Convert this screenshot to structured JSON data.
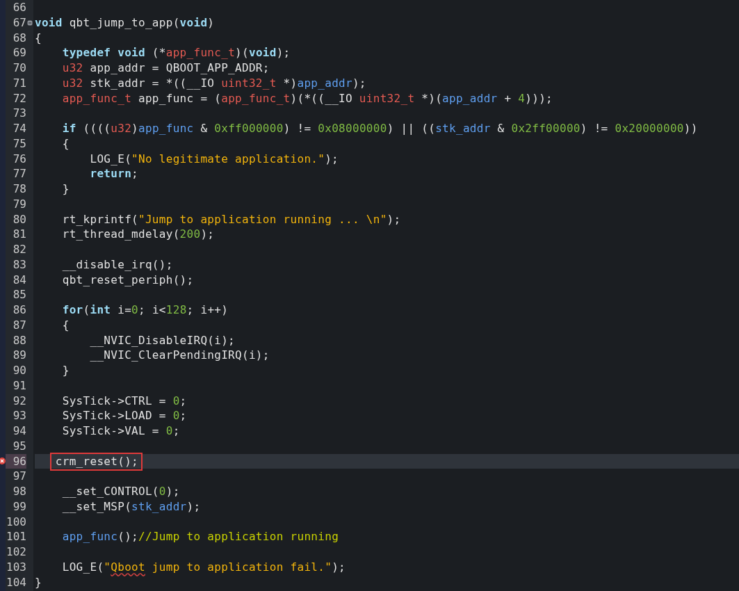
{
  "editor": {
    "lines": [
      {
        "number": "66",
        "current": false,
        "error": false
      },
      {
        "number": "67",
        "current": false,
        "error": false,
        "expanded": true,
        "tokens": [
          {
            "kind": "keyword",
            "text": "void"
          },
          {
            "kind": "plain",
            "text": " qbt_jump_to_app("
          },
          {
            "kind": "keyword",
            "text": "void"
          },
          {
            "kind": "plain",
            "text": ")"
          }
        ]
      },
      {
        "number": "68",
        "current": false,
        "error": false,
        "tokens": [
          {
            "kind": "plain",
            "text": "{"
          }
        ]
      },
      {
        "number": "69",
        "current": false,
        "error": false,
        "tokens": [
          {
            "kind": "keyword",
            "text": "    typedef void"
          },
          {
            "kind": "plain",
            "text": " (*"
          },
          {
            "kind": "type",
            "text": "app_func_t"
          },
          {
            "kind": "plain",
            "text": ")("
          },
          {
            "kind": "keyword",
            "text": "void"
          },
          {
            "kind": "plain",
            "text": ");"
          }
        ]
      },
      {
        "number": "70",
        "current": false,
        "error": false,
        "tokens": [
          {
            "kind": "type",
            "text": "    u32"
          },
          {
            "kind": "plain",
            "text": " app_addr = QBOOT_APP_ADDR;"
          }
        ]
      },
      {
        "number": "71",
        "current": false,
        "error": false,
        "tokens": [
          {
            "kind": "type",
            "text": "    u32"
          },
          {
            "kind": "plain",
            "text": " stk_addr = *((__IO "
          },
          {
            "kind": "type",
            "text": "uint32_t"
          },
          {
            "kind": "plain",
            "text": " *)"
          },
          {
            "kind": "var",
            "text": "app_addr"
          },
          {
            "kind": "plain",
            "text": ");"
          }
        ]
      },
      {
        "number": "72",
        "current": false,
        "error": false,
        "tokens": [
          {
            "kind": "type",
            "text": "    app_func_t"
          },
          {
            "kind": "plain",
            "text": " app_func = ("
          },
          {
            "kind": "type",
            "text": "app_func_t"
          },
          {
            "kind": "plain",
            "text": ")(*((__IO "
          },
          {
            "kind": "type",
            "text": "uint32_t"
          },
          {
            "kind": "plain",
            "text": " *)("
          },
          {
            "kind": "var",
            "text": "app_addr"
          },
          {
            "kind": "plain",
            "text": " + "
          },
          {
            "kind": "number",
            "text": "4"
          },
          {
            "kind": "plain",
            "text": ")));"
          }
        ]
      },
      {
        "number": "73",
        "current": false,
        "error": false
      },
      {
        "number": "74",
        "current": false,
        "error": false,
        "tokens": [
          {
            "kind": "keyword",
            "text": "    if"
          },
          {
            "kind": "plain",
            "text": " (((("
          },
          {
            "kind": "type",
            "text": "u32"
          },
          {
            "kind": "plain",
            "text": ")"
          },
          {
            "kind": "var",
            "text": "app_func"
          },
          {
            "kind": "plain",
            "text": " & "
          },
          {
            "kind": "number",
            "text": "0xff000000"
          },
          {
            "kind": "plain",
            "text": ") != "
          },
          {
            "kind": "number",
            "text": "0x08000000"
          },
          {
            "kind": "plain",
            "text": ") || (("
          },
          {
            "kind": "var",
            "text": "stk_addr"
          },
          {
            "kind": "plain",
            "text": " & "
          },
          {
            "kind": "number",
            "text": "0x2ff00000"
          },
          {
            "kind": "plain",
            "text": ") != "
          },
          {
            "kind": "number",
            "text": "0x20000000"
          },
          {
            "kind": "plain",
            "text": "))"
          }
        ]
      },
      {
        "number": "75",
        "current": false,
        "error": false,
        "tokens": [
          {
            "kind": "plain",
            "text": "    {"
          }
        ]
      },
      {
        "number": "76",
        "current": false,
        "error": false,
        "tokens": [
          {
            "kind": "plain",
            "text": "        LOG_E("
          },
          {
            "kind": "string",
            "text": "\"No legitimate application.\""
          },
          {
            "kind": "plain",
            "text": ");"
          }
        ]
      },
      {
        "number": "77",
        "current": false,
        "error": false,
        "tokens": [
          {
            "kind": "keyword",
            "text": "        return"
          },
          {
            "kind": "plain",
            "text": ";"
          }
        ]
      },
      {
        "number": "78",
        "current": false,
        "error": false,
        "tokens": [
          {
            "kind": "plain",
            "text": "    }"
          }
        ]
      },
      {
        "number": "79",
        "current": false,
        "error": false
      },
      {
        "number": "80",
        "current": false,
        "error": false,
        "tokens": [
          {
            "kind": "plain",
            "text": "    rt_kprintf("
          },
          {
            "kind": "string",
            "text": "\"Jump to application running ... \\n\""
          },
          {
            "kind": "plain",
            "text": ");"
          }
        ]
      },
      {
        "number": "81",
        "current": false,
        "error": false,
        "tokens": [
          {
            "kind": "plain",
            "text": "    rt_thread_mdelay("
          },
          {
            "kind": "number",
            "text": "200"
          },
          {
            "kind": "plain",
            "text": ");"
          }
        ]
      },
      {
        "number": "82",
        "current": false,
        "error": false
      },
      {
        "number": "83",
        "current": false,
        "error": false,
        "tokens": [
          {
            "kind": "plain",
            "text": "    __disable_irq();"
          }
        ]
      },
      {
        "number": "84",
        "current": false,
        "error": false,
        "tokens": [
          {
            "kind": "plain",
            "text": "    qbt_reset_periph();"
          }
        ]
      },
      {
        "number": "85",
        "current": false,
        "error": false
      },
      {
        "number": "86",
        "current": false,
        "error": false,
        "tokens": [
          {
            "kind": "keyword",
            "text": "    for"
          },
          {
            "kind": "plain",
            "text": "("
          },
          {
            "kind": "keyword",
            "text": "int"
          },
          {
            "kind": "plain",
            "text": " i="
          },
          {
            "kind": "number",
            "text": "0"
          },
          {
            "kind": "plain",
            "text": "; i<"
          },
          {
            "kind": "number",
            "text": "128"
          },
          {
            "kind": "plain",
            "text": "; i++)"
          }
        ]
      },
      {
        "number": "87",
        "current": false,
        "error": false,
        "tokens": [
          {
            "kind": "plain",
            "text": "    {"
          }
        ]
      },
      {
        "number": "88",
        "current": false,
        "error": false,
        "tokens": [
          {
            "kind": "plain",
            "text": "        __NVIC_DisableIRQ(i);"
          }
        ]
      },
      {
        "number": "89",
        "current": false,
        "error": false,
        "tokens": [
          {
            "kind": "plain",
            "text": "        __NVIC_ClearPendingIRQ(i);"
          }
        ]
      },
      {
        "number": "90",
        "current": false,
        "error": false,
        "tokens": [
          {
            "kind": "plain",
            "text": "    }"
          }
        ]
      },
      {
        "number": "91",
        "current": false,
        "error": false
      },
      {
        "number": "92",
        "current": false,
        "error": false,
        "tokens": [
          {
            "kind": "plain",
            "text": "    SysTick->CTRL = "
          },
          {
            "kind": "number",
            "text": "0"
          },
          {
            "kind": "plain",
            "text": ";"
          }
        ]
      },
      {
        "number": "93",
        "current": false,
        "error": false,
        "tokens": [
          {
            "kind": "plain",
            "text": "    SysTick->LOAD = "
          },
          {
            "kind": "number",
            "text": "0"
          },
          {
            "kind": "plain",
            "text": ";"
          }
        ]
      },
      {
        "number": "94",
        "current": false,
        "error": false,
        "tokens": [
          {
            "kind": "plain",
            "text": "    SysTick->VAL = "
          },
          {
            "kind": "number",
            "text": "0"
          },
          {
            "kind": "plain",
            "text": ";"
          }
        ]
      },
      {
        "number": "95",
        "current": false,
        "error": false
      },
      {
        "number": "96",
        "current": true,
        "error": true,
        "tokens": [
          {
            "kind": "plain",
            "text": "    crm_reset();",
            "boxed": true
          }
        ]
      },
      {
        "number": "97",
        "current": false,
        "error": false
      },
      {
        "number": "98",
        "current": false,
        "error": false,
        "tokens": [
          {
            "kind": "plain",
            "text": "    __set_CONTROL("
          },
          {
            "kind": "number",
            "text": "0"
          },
          {
            "kind": "plain",
            "text": ");"
          }
        ]
      },
      {
        "number": "99",
        "current": false,
        "error": false,
        "tokens": [
          {
            "kind": "plain",
            "text": "    __set_MSP("
          },
          {
            "kind": "var",
            "text": "stk_addr"
          },
          {
            "kind": "plain",
            "text": ");"
          }
        ]
      },
      {
        "number": "100",
        "current": false,
        "error": false
      },
      {
        "number": "101",
        "current": false,
        "error": false,
        "tokens": [
          {
            "kind": "var",
            "text": "    app_func"
          },
          {
            "kind": "plain",
            "text": "();"
          },
          {
            "kind": "comment",
            "text": "//Jump to application running"
          }
        ]
      },
      {
        "number": "102",
        "current": false,
        "error": false
      },
      {
        "number": "103",
        "current": false,
        "error": false,
        "tokens": [
          {
            "kind": "plain",
            "text": "    LOG_E("
          },
          {
            "kind": "string",
            "text": "\""
          },
          {
            "kind": "string",
            "text": "Qboot",
            "misspelled": true
          },
          {
            "kind": "string",
            "text": " jump to application fail.\""
          },
          {
            "kind": "plain",
            "text": ");"
          }
        ]
      },
      {
        "number": "104",
        "current": false,
        "error": false,
        "tokens": [
          {
            "kind": "plain",
            "text": "}"
          }
        ]
      }
    ]
  }
}
